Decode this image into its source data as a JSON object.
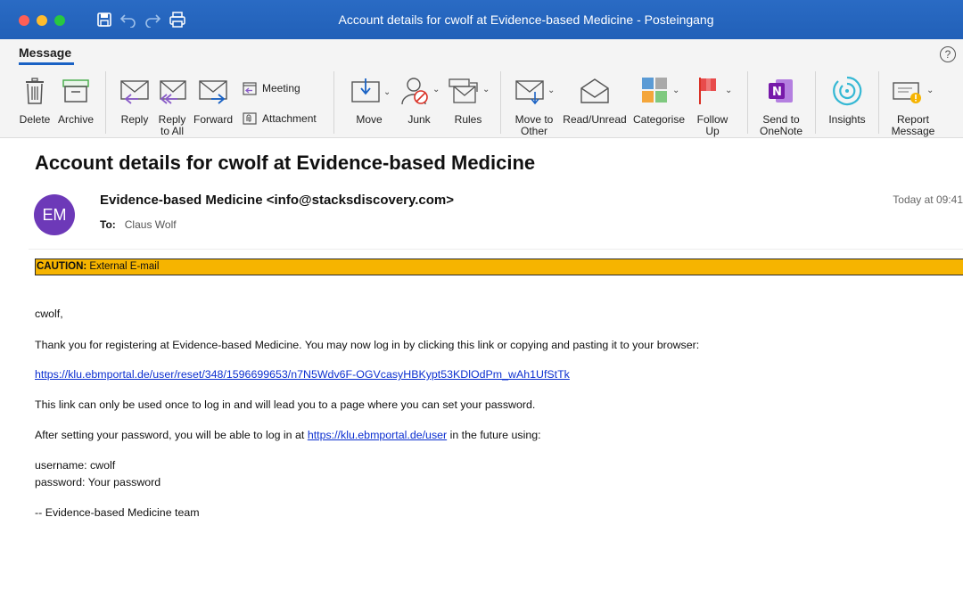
{
  "window": {
    "title": "Account details for cwolf at Evidence-based Medicine - Posteingang"
  },
  "ribbon": {
    "tab": "Message",
    "help_glyph": "?",
    "buttons": {
      "delete": "Delete",
      "archive": "Archive",
      "reply": "Reply",
      "reply_all": "Reply\nto All",
      "forward": "Forward",
      "meeting": "Meeting",
      "attachment": "Attachment",
      "move": "Move",
      "junk": "Junk",
      "rules": "Rules",
      "move_to_other": "Move to\nOther",
      "read_unread": "Read/Unread",
      "categorise": "Categorise",
      "follow_up": "Follow\nUp",
      "send_to_onenote": "Send to\nOneNote",
      "insights": "Insights",
      "report_message": "Report\nMessage"
    },
    "colors": {
      "accent": "#1a62c4",
      "titlebar": "#2160b8"
    }
  },
  "message": {
    "subject": "Account details for cwolf at Evidence-based Medicine",
    "avatar_initials": "EM",
    "avatar_color": "#6d39b8",
    "sender": "Evidence-based Medicine <info@stacksdiscovery.com>",
    "to_label": "To:",
    "to_name": "Claus Wolf",
    "date": "Today at 09:41",
    "caution_label": "CAUTION:",
    "caution_text": " External E-mail",
    "caution_color": "#f6b400",
    "body": {
      "greeting": "cwolf,",
      "p1": "Thank you for registering at Evidence-based Medicine. You may now log in by clicking this link or copying and pasting it to your browser:",
      "reset_link": "https://klu.ebmportal.de/user/reset/348/1596699653/n7N5Wdv6F-OGVcasyHBKypt53KDlOdPm_wAh1UfStTk",
      "p2": "This link can only be used once to log in and will lead you to a page where you can set your password.",
      "p3_before": "After setting your password, you will be able to log in at ",
      "p3_link": "https://klu.ebmportal.de/user",
      "p3_after": " in the future using:",
      "username_line": "username: cwolf",
      "password_line": "password: Your password",
      "signoff": "-- Evidence-based Medicine team"
    }
  }
}
